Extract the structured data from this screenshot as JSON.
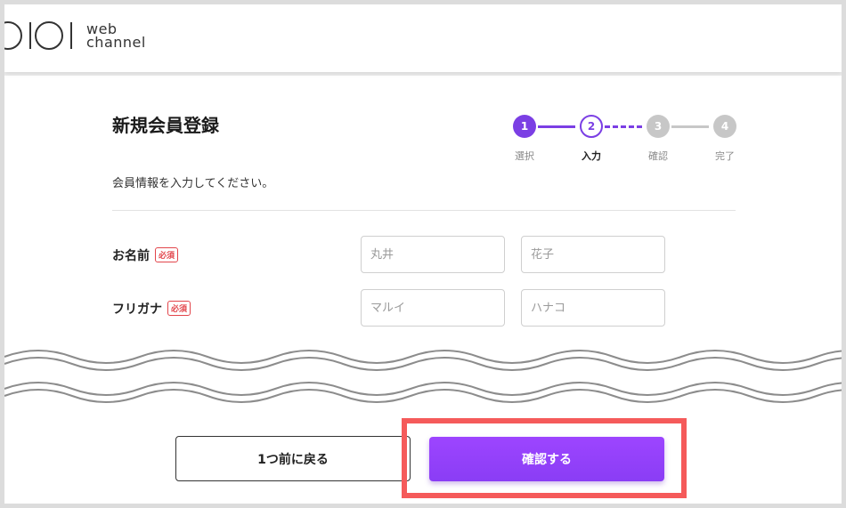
{
  "header": {
    "logo_line1": "web",
    "logo_line2": "channel"
  },
  "page": {
    "title": "新規会員登録",
    "intro": "会員情報を入力してください。"
  },
  "stepper": {
    "steps": [
      {
        "number": "1",
        "label": "選択",
        "state": "done"
      },
      {
        "number": "2",
        "label": "入力",
        "state": "current"
      },
      {
        "number": "3",
        "label": "確認",
        "state": "todo"
      },
      {
        "number": "4",
        "label": "完了",
        "state": "todo"
      }
    ]
  },
  "form": {
    "required_badge": "必須",
    "name": {
      "label": "お名前",
      "last_placeholder": "丸井",
      "first_placeholder": "花子"
    },
    "kana": {
      "label": "フリガナ",
      "last_placeholder": "マルイ",
      "first_placeholder": "ハナコ"
    }
  },
  "actions": {
    "back_label": "1つ前に戻る",
    "confirm_label": "確認する"
  },
  "colors": {
    "accent": "#7b3fe4",
    "required": "#e2454b",
    "highlight": "#f55a5a"
  }
}
